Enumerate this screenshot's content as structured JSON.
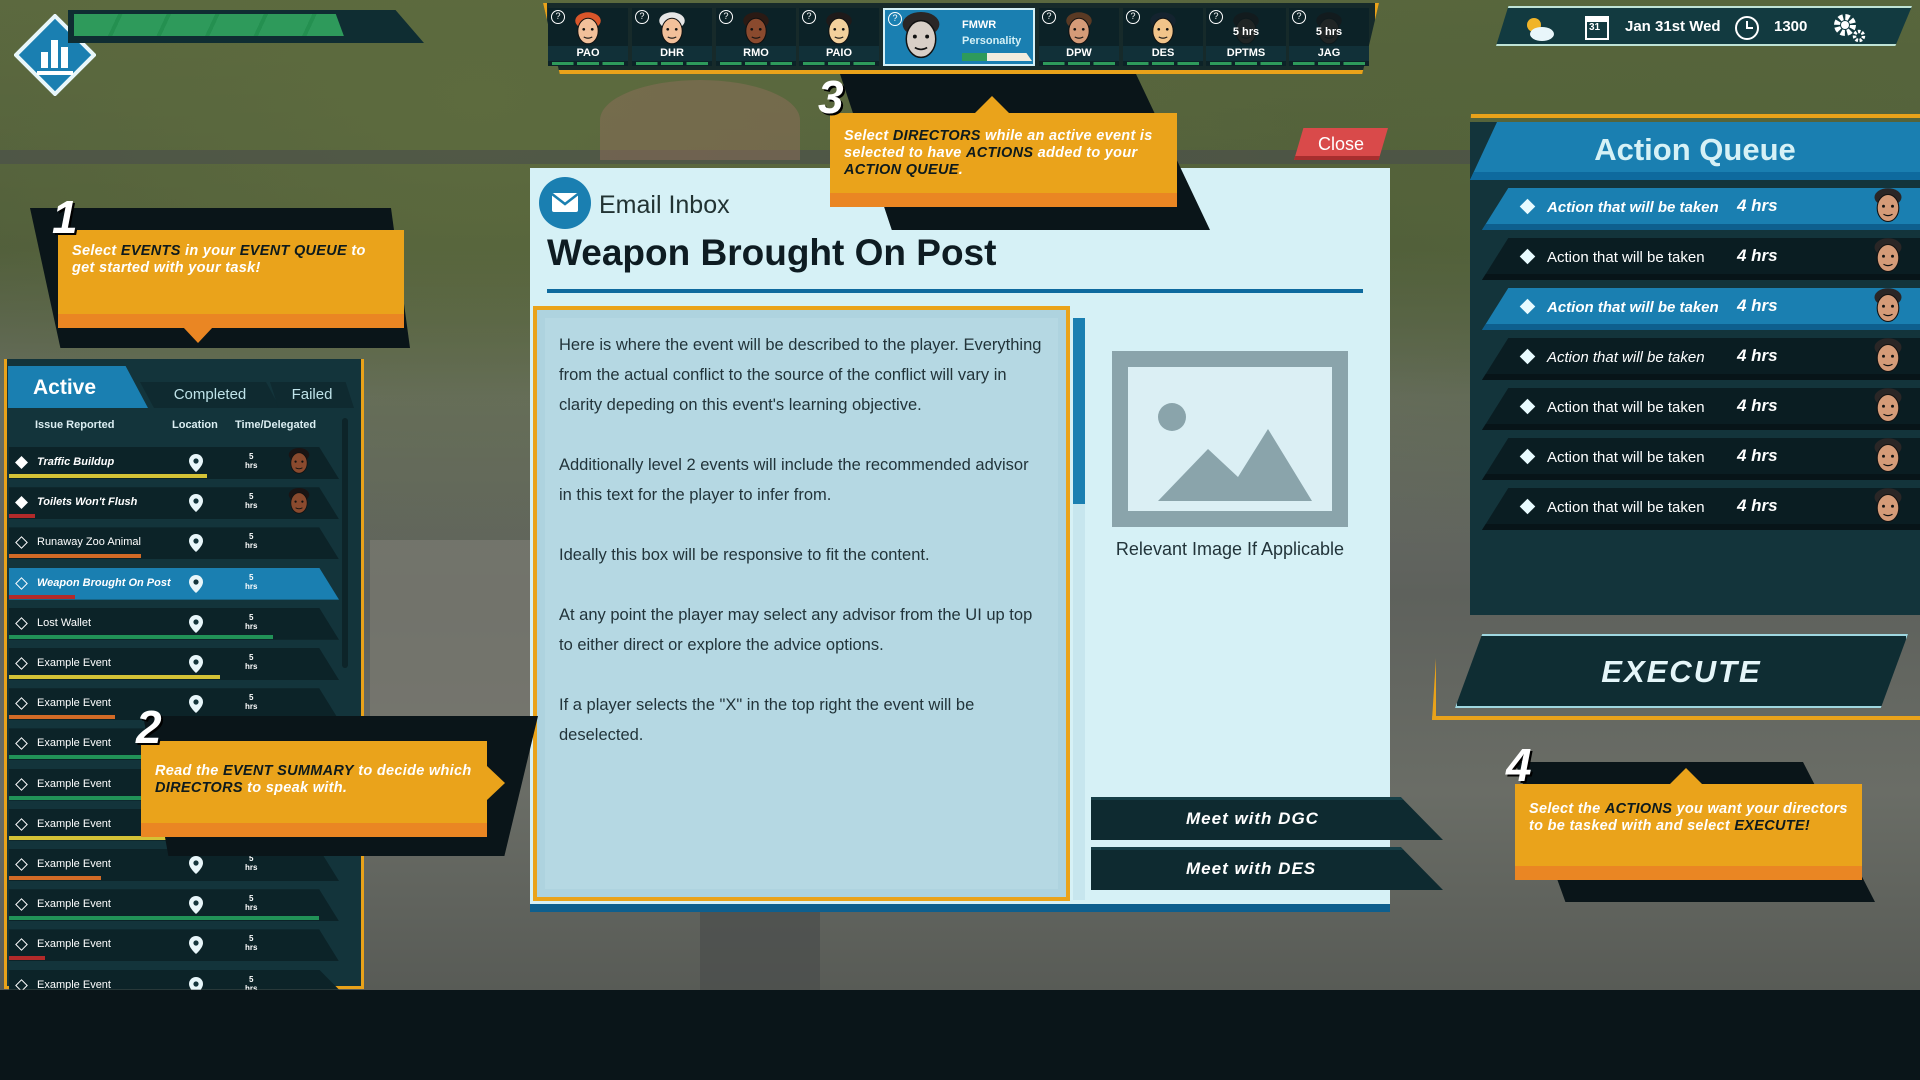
{
  "hud": {
    "health_fraction": 0.78,
    "date_day": "31",
    "date": "Jan 31st Wed",
    "time": "1300",
    "weather_icon": "partly-cloudy-icon"
  },
  "directors": [
    {
      "code": "PAO",
      "skin": "#f2c09a",
      "hair": "#d9562a"
    },
    {
      "code": "DHR",
      "skin": "#f2c09a",
      "hair": "#e6e6e6"
    },
    {
      "code": "RMO",
      "skin": "#8a4a2e",
      "hair": "#2a1a14"
    },
    {
      "code": "PAIO",
      "skin": "#f3d09c",
      "hair": "#1e1a1a"
    },
    {
      "code": "FMWR",
      "subtitle": "Personality",
      "skin": "#d8cfc7",
      "hair": "#2a2626",
      "progress": 0.35,
      "selected": true
    },
    {
      "code": "DPW",
      "skin": "#d59b78",
      "hair": "#5a3a24"
    },
    {
      "code": "DES",
      "skin": "#f1c48a",
      "hair": "#14232f"
    },
    {
      "code": "DPTMS",
      "time": "5 hrs",
      "skin": "#3a2a24",
      "hair": "#1a1414",
      "dim": true
    },
    {
      "code": "JAG",
      "time": "5 hrs",
      "skin": "#3a2a24",
      "hair": "#1a1414",
      "dim": true
    }
  ],
  "callouts": {
    "c1": {
      "num": "1",
      "parts": [
        [
          "Select ",
          false
        ],
        [
          "EVENTS",
          true
        ],
        [
          " in your ",
          false
        ],
        [
          "EVENT QUEUE",
          true
        ],
        [
          " to get started with your task!",
          false
        ]
      ]
    },
    "c2": {
      "num": "2",
      "parts": [
        [
          "Read the ",
          false
        ],
        [
          "EVENT SUMMARY",
          true
        ],
        [
          " to decide which ",
          false
        ],
        [
          "DIRECTORS",
          true
        ],
        [
          " to speak with.",
          false
        ]
      ]
    },
    "c3": {
      "num": "3",
      "parts": [
        [
          "Select ",
          false
        ],
        [
          "DIRECTORS",
          true
        ],
        [
          " while an active event is selected to have ",
          false
        ],
        [
          "ACTIONS",
          true
        ],
        [
          " added to your ",
          false
        ],
        [
          "ACTION QUEUE",
          true
        ],
        [
          ".",
          false
        ]
      ]
    },
    "c4": {
      "num": "4",
      "parts": [
        [
          "Select the ",
          false
        ],
        [
          "ACTIONS",
          true
        ],
        [
          " you want your directors to be tasked with and select ",
          false
        ],
        [
          "EXECUTE!",
          true
        ]
      ]
    }
  },
  "events": {
    "tabs": {
      "active": "Active",
      "completed": "Completed",
      "failed": "Failed"
    },
    "headers": {
      "issue": "Issue Reported",
      "location": "Location",
      "time": "Time/Delegated"
    },
    "rows": [
      {
        "name": "Traffic Buildup",
        "time": "5",
        "unit": "hrs",
        "bold": true,
        "filled": true,
        "bar": "#d4c236",
        "progress": 0.6,
        "delegate": "#8a4a2e"
      },
      {
        "name": "Toilets Won't Flush",
        "time": "5",
        "unit": "hrs",
        "bold": true,
        "filled": true,
        "bar": "#b22a2a",
        "progress": 0.08,
        "delegate": "#8a4a2e"
      },
      {
        "name": "Runaway Zoo Animal",
        "time": "5",
        "unit": "hrs",
        "bar": "#d26a26",
        "progress": 0.4
      },
      {
        "name": "Weapon Brought On Post",
        "time": "5",
        "unit": "hrs",
        "bold": true,
        "selected": true,
        "bar": "#b22a2a",
        "progress": 0.2
      },
      {
        "name": "Lost Wallet",
        "time": "5",
        "unit": "hrs",
        "bar": "#219257",
        "progress": 0.8
      },
      {
        "name": "Example Event",
        "time": "5",
        "unit": "hrs",
        "bar": "#d4c236",
        "progress": 0.64
      },
      {
        "name": "Example Event",
        "time": "5",
        "unit": "hrs",
        "bar": "#d26a26",
        "progress": 0.32
      },
      {
        "name": "Example Event",
        "time": "5",
        "unit": "hrs",
        "bar": "#219257",
        "progress": 0.4
      },
      {
        "name": "Example Event",
        "time": "5",
        "unit": "hrs",
        "bar": "#219257",
        "progress": 0.5
      },
      {
        "name": "Example Event",
        "time": "5",
        "unit": "hrs",
        "bar": "#d4c236",
        "progress": 0.52
      },
      {
        "name": "Example Event",
        "time": "5",
        "unit": "hrs",
        "bar": "#d26a26",
        "progress": 0.28
      },
      {
        "name": "Example Event",
        "time": "5",
        "unit": "hrs",
        "bar": "#219257",
        "progress": 0.94
      },
      {
        "name": "Example Event",
        "time": "5",
        "unit": "hrs",
        "bar": "#b22a2a",
        "progress": 0.11
      },
      {
        "name": "Example Event",
        "time": "5",
        "unit": "hrs",
        "bar": "#219257",
        "progress": 0.0
      }
    ]
  },
  "email": {
    "close_label": "Close",
    "inbox_label": "Email Inbox",
    "title": "Weapon Brought On Post",
    "paragraphs": [
      "Here is where the event will be described to the player. Everything from the actual conflict to the source of the conflict will vary in clarity depeding on this event's learning objective.",
      "Additionally level 2 events will include the recommended advisor in this text for the player to infer from.",
      "Ideally this box will be responsive to fit the content.",
      "At any point the player may select any advisor from the UI up top to either direct or explore the advice options.",
      "If a player selects the \"X\" in the top right the event will be deselected."
    ],
    "image_caption": "Relevant Image If Applicable",
    "meet_buttons": [
      "Meet with DGC",
      "Meet with DES"
    ]
  },
  "action_queue": {
    "title": "Action Queue",
    "rows": [
      {
        "label": "Action that will be taken",
        "time": "4 hrs",
        "highlight": true,
        "style": "bi"
      },
      {
        "label": "Action that will be taken",
        "time": "4 hrs",
        "style": ""
      },
      {
        "label": "Action that will be taken",
        "time": "4 hrs",
        "highlight": true,
        "style": "bi"
      },
      {
        "label": "Action that will be taken",
        "time": "4 hrs",
        "style": "i"
      },
      {
        "label": "Action that will be taken",
        "time": "4 hrs",
        "style": ""
      },
      {
        "label": "Action that will be taken",
        "time": "4 hrs",
        "style": ""
      },
      {
        "label": "Action that will be taken",
        "time": "4 hrs",
        "style": ""
      }
    ],
    "execute_label": "EXECUTE"
  },
  "colors": {
    "accent_orange": "#eaa31b",
    "accent_blue": "#1a7fb1",
    "panel_dark": "#13343b",
    "close_red": "#d94a4a"
  }
}
